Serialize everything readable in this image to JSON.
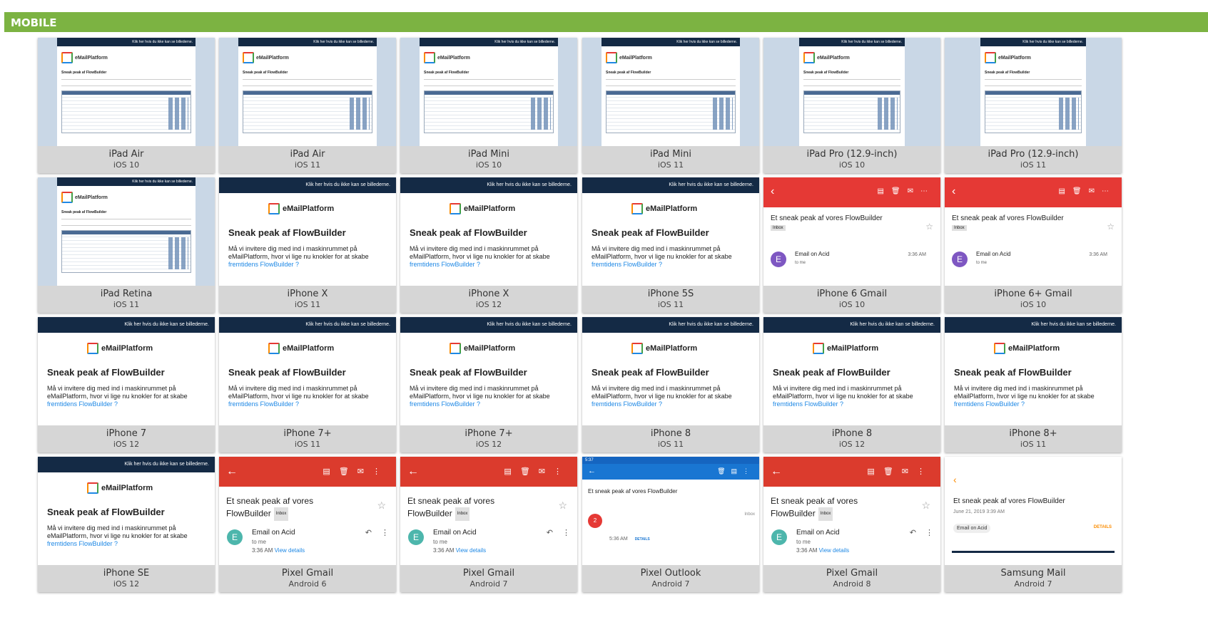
{
  "section": {
    "title": "MOBILE"
  },
  "email": {
    "banner_text": "Klik her hvis du ikke kan se billederne.",
    "logo_text": "eMailPlatform",
    "heading": "Sneak peak af FlowBuilder",
    "body_line1": "Må vi invitere dig med ind i maskinrummet på",
    "body_line2": "eMailPlatform, hvor vi lige nu knokler for at skabe",
    "body_link": "fremtidens FlowBuilder ?",
    "body_short": "Må vi invitere dig med ind i"
  },
  "gmail": {
    "subject_line1": "Et sneak peak af vores",
    "subject_line2": "FlowBuilder",
    "subject_full": "Et sneak peak af vores FlowBuilder",
    "inbox_badge": "Inbox",
    "avatar_letter": "E",
    "from": "Email on Acid",
    "to": "to me",
    "time": "3:36 AM",
    "view_details": "View details"
  },
  "outlook": {
    "status_time": "5:37",
    "subject": "Et sneak peak af vores FlowBuilder",
    "folder": "Inbox",
    "count": "2",
    "time": "5:36 AM",
    "details": "DETAILS"
  },
  "samsung": {
    "subject": "Et sneak peak af vores FlowBuilder",
    "date": "June 21, 2019 3:39 AM",
    "from_chip": "Email on Acid",
    "details": "DETAILS"
  },
  "devices": [
    {
      "name": "iPad Air",
      "os": "iOS 10"
    },
    {
      "name": "iPad Air",
      "os": "iOS 11"
    },
    {
      "name": "iPad Mini",
      "os": "iOS 10"
    },
    {
      "name": "iPad Mini",
      "os": "iOS 11"
    },
    {
      "name": "iPad Pro (12.9-inch)",
      "os": "iOS 10"
    },
    {
      "name": "iPad Pro (12.9-inch)",
      "os": "iOS 11"
    },
    {
      "name": "iPad Retina",
      "os": "iOS 11"
    },
    {
      "name": "iPhone X",
      "os": "iOS 11"
    },
    {
      "name": "iPhone X",
      "os": "iOS 12"
    },
    {
      "name": "iPhone 5S",
      "os": "iOS 11"
    },
    {
      "name": "iPhone 6 Gmail",
      "os": "iOS 10"
    },
    {
      "name": "iPhone 6+ Gmail",
      "os": "iOS 10"
    },
    {
      "name": "iPhone 7",
      "os": "iOS 12"
    },
    {
      "name": "iPhone 7+",
      "os": "iOS 11"
    },
    {
      "name": "iPhone 7+",
      "os": "iOS 12"
    },
    {
      "name": "iPhone 8",
      "os": "iOS 11"
    },
    {
      "name": "iPhone 8",
      "os": "iOS 12"
    },
    {
      "name": "iPhone 8+",
      "os": "iOS 11"
    },
    {
      "name": "iPhone SE",
      "os": "iOS 12"
    },
    {
      "name": "Pixel Gmail",
      "os": "Android 6"
    },
    {
      "name": "Pixel Gmail",
      "os": "Android 7"
    },
    {
      "name": "Pixel Outlook",
      "os": "Android 7"
    },
    {
      "name": "Pixel Gmail",
      "os": "Android 8"
    },
    {
      "name": "Samsung Mail",
      "os": "Android 7"
    }
  ],
  "colors": {
    "header_green": "#7cb342",
    "gmail_red": "#db3b2d",
    "outlook_blue": "#1976d2",
    "banner_navy": "#142a45"
  }
}
